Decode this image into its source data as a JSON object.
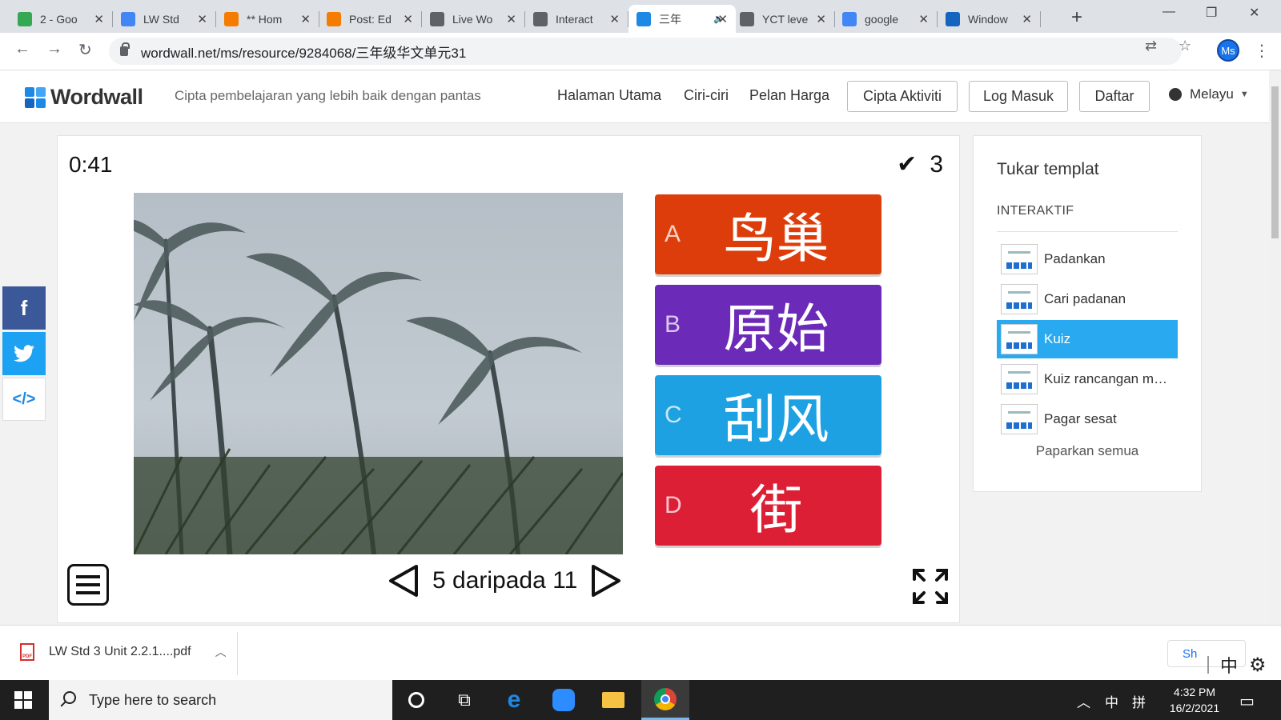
{
  "browser": {
    "tabs": [
      {
        "title": "2 - Goo",
        "icon": "google-drive-icon",
        "color": "#34a853"
      },
      {
        "title": "LW Std",
        "icon": "google-docs-icon",
        "color": "#4285f4"
      },
      {
        "title": "** Hom",
        "icon": "blogger-icon",
        "color": "#f57c00"
      },
      {
        "title": "Post: Ed",
        "icon": "blogger-icon",
        "color": "#f57c00"
      },
      {
        "title": "Live Wo",
        "icon": "globe-icon",
        "color": "#5f6368"
      },
      {
        "title": "Interact",
        "icon": "globe-icon",
        "color": "#5f6368"
      },
      {
        "title": "三年",
        "icon": "wordwall-icon",
        "color": "#1e88e5",
        "active": true
      },
      {
        "title": "YCT leve",
        "icon": "globe-icon",
        "color": "#5f6368"
      },
      {
        "title": "google",
        "icon": "google-icon",
        "color": "#4285f4"
      },
      {
        "title": "Window",
        "icon": "bot-icon",
        "color": "#1565c0"
      }
    ],
    "url": "wordwall.net/ms/resource/9284068/三年级华文单元31",
    "profile_initials": "Ms"
  },
  "site": {
    "logo": "Wordwall",
    "tagline": "Cipta pembelajaran yang lebih baik dengan pantas",
    "nav": [
      "Halaman Utama",
      "Ciri-ciri",
      "Pelan Harga"
    ],
    "create_button": "Cipta Aktiviti",
    "login_button": "Log Masuk",
    "register_button": "Daftar",
    "language": "Melayu"
  },
  "quiz": {
    "timer": "0:41",
    "score": "3",
    "answers": [
      {
        "letter": "A",
        "text": "鸟巢",
        "color": "#dd3d0b"
      },
      {
        "letter": "B",
        "text": "原始",
        "color": "#6c2ab8"
      },
      {
        "letter": "C",
        "text": "刮风",
        "color": "#1da1e2"
      },
      {
        "letter": "D",
        "text": "街",
        "color": "#dc1f35"
      }
    ],
    "pager": "5 daripada 11"
  },
  "side_panel": {
    "title": "Tukar templat",
    "section": "INTERAKTIF",
    "templates": [
      "Padankan",
      "Cari padanan",
      "Kuiz",
      "Kuiz rancangan ma...",
      "Pagar sesat"
    ],
    "active_template": "Kuiz",
    "show_all": "Paparkan semua"
  },
  "downloads": {
    "file": "LW Std 3 Unit 2.2.1....pdf",
    "show_all": "Sh"
  },
  "ime": {
    "mode": "中"
  },
  "taskbar": {
    "search_placeholder": "Type here to search",
    "time": "4:32 PM",
    "date": "16/2/2021",
    "tray_lang": "中",
    "tray_layout": "拼"
  }
}
